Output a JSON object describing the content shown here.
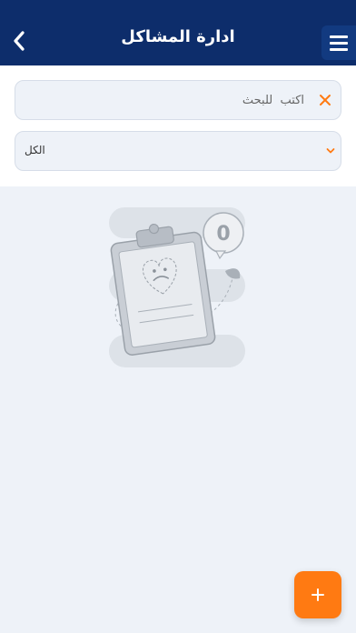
{
  "header": {
    "title": "ادارة المشاكل",
    "back_icon": "chevron-left-icon",
    "menu_icon": "hamburger-menu-icon",
    "background_color": "#0d2d6b"
  },
  "search": {
    "placeholder": "اكتب  للبحث",
    "value": "",
    "clear_icon": "close-icon"
  },
  "filter": {
    "selected": "الكل",
    "icon": "chevron-down-icon"
  },
  "empty_state": {
    "illustration": "empty-clipboard-icon",
    "badge_count": "0"
  },
  "fab": {
    "icon": "plus-icon",
    "color": "#ff7a12"
  },
  "colors": {
    "accent": "#ff7a12",
    "page_bg": "#eef2f8"
  }
}
